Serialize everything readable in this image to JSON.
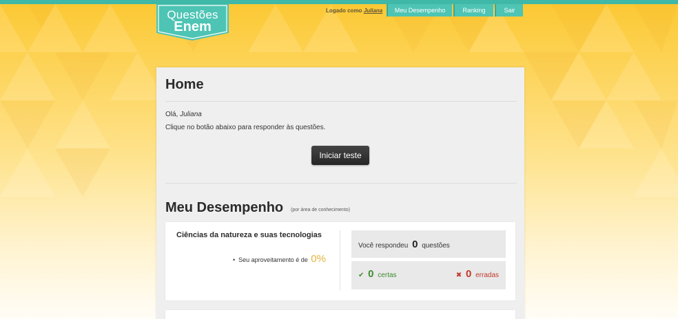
{
  "logo": {
    "line1": "Questões",
    "line2": "Enem"
  },
  "nav": {
    "logged_prefix": "Logado como",
    "username": "Juliana",
    "items": [
      {
        "label": "Meu Desempenho"
      },
      {
        "label": "Ranking"
      },
      {
        "label": "Sair"
      }
    ]
  },
  "home": {
    "title": "Home",
    "greeting": "Olá,",
    "username": "Juliana",
    "instruction": "Clique no botão abaixo para responder às questões.",
    "start_button": "Iniciar teste"
  },
  "performance": {
    "title": "Meu Desempenho",
    "subtitle": "(por área de conhecimento)",
    "areas": [
      {
        "name": "Ciências da natureza e suas tecnologias",
        "aprov_label": "Seu aproveitamento é de",
        "aprov_value": "0%",
        "answered_prefix": "Você respondeu",
        "answered_count": "0",
        "answered_suffix": "questões",
        "correct_count": "0",
        "correct_label": "certas",
        "wrong_count": "0",
        "wrong_label": "erradas"
      }
    ]
  },
  "colors": {
    "accent": "#4ec4b4",
    "background": "#fcc832",
    "success": "#3d8c2f",
    "danger": "#c0392b",
    "highlight": "#e7b53a"
  },
  "icons": {
    "correct": "check-icon",
    "wrong": "x-icon"
  }
}
